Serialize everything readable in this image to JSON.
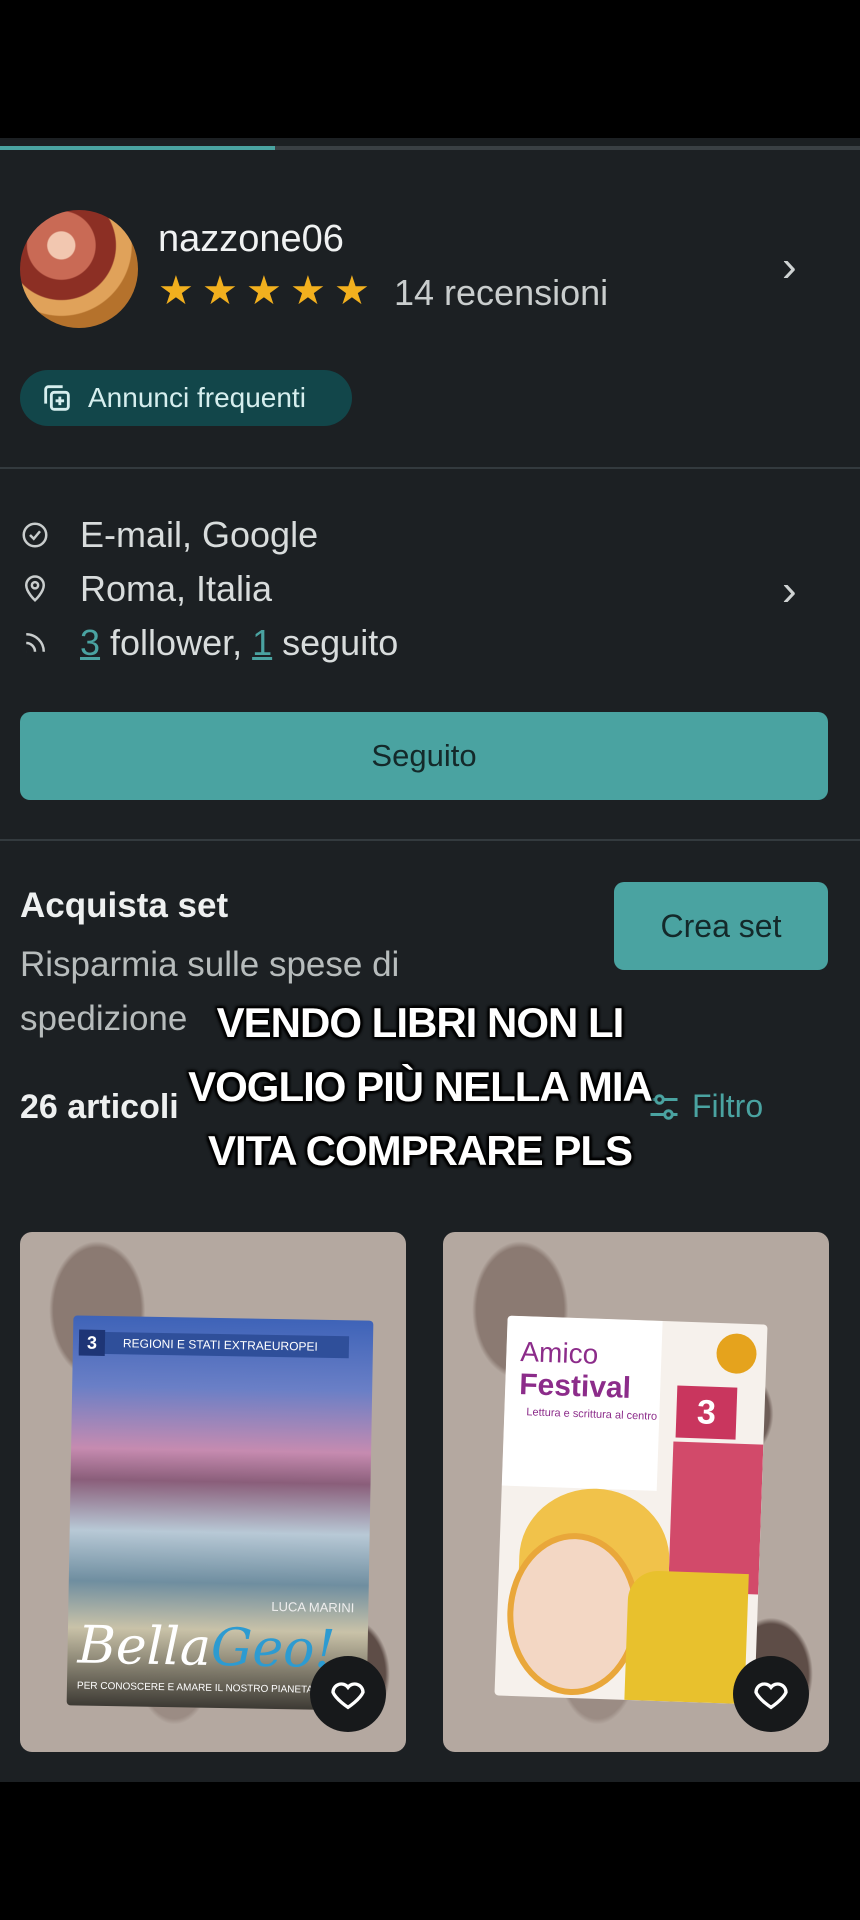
{
  "story_progress": 0.32,
  "profile": {
    "username": "nazzone06",
    "rating_stars": 5,
    "reviews": "14 recensioni",
    "badge": "Annunci frequenti"
  },
  "info": {
    "verified": "E-mail, Google",
    "location": "Roma, Italia",
    "followers_num": "3",
    "followers_label": " follower, ",
    "following_num": "1",
    "following_label": " seguito"
  },
  "follow_button": "Seguito",
  "bundle": {
    "title": "Acquista set",
    "subtitle": "Risparmia sulle spese di spedizione",
    "create_button": "Crea set"
  },
  "items_count": "26 articoli",
  "filter_label": "Filtro",
  "overlay_caption": {
    "line1": "VENDO LIBRI NON LI",
    "line2": "VOGLIO PIÙ NELLA MIA",
    "line3": "VITA COMPRARE PLS"
  },
  "listings": [
    {
      "book_number": "3",
      "band_text": "REGIONI E STATI EXTRAEUROPEI",
      "author": "LUCA MARINI",
      "title_a": "Bella",
      "title_b": "Geo!",
      "tagline": "PER CONOSCERE E AMARE IL NOSTRO PIANETA"
    },
    {
      "book_number": "3",
      "title_a": "Amico",
      "title_b": "Festival",
      "tagline": "Lettura e scrittura al centro"
    }
  ],
  "colors": {
    "accent": "#4aa3a1",
    "star": "#f2b01e",
    "background": "#1c2023"
  }
}
